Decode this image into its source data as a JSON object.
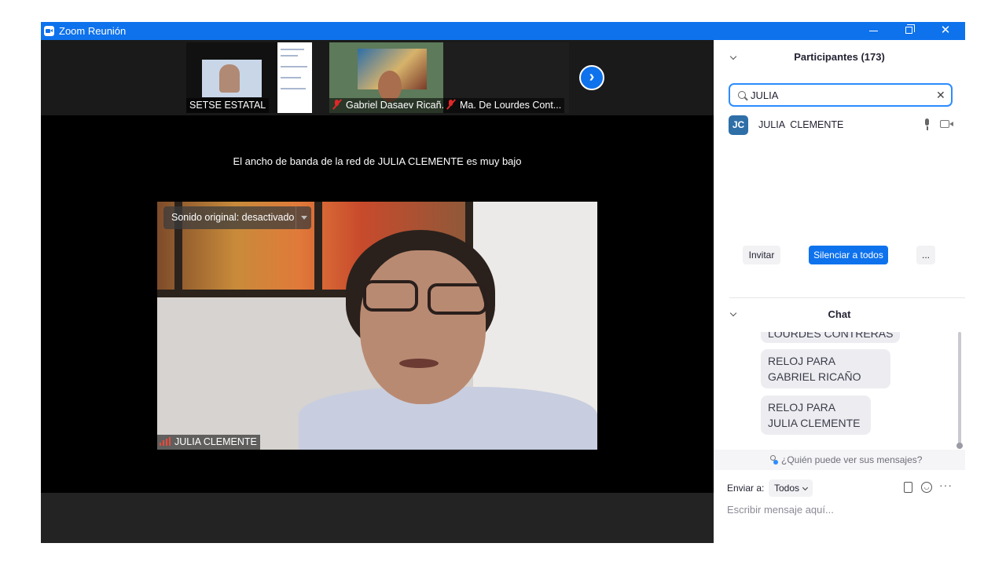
{
  "window": {
    "title": "Zoom Reunión",
    "accent_color": "#0e72ed",
    "controls": {
      "minimize_icon": "minimize-icon",
      "restore_icon": "restore-icon",
      "close_icon": "close-icon",
      "close_glyph": "✕"
    }
  },
  "thumbnails": [
    {
      "name": "SETSE ESTATAL",
      "muted": false
    },
    {
      "name": "Gabriel Dasaev Ricañ...",
      "muted": true
    },
    {
      "name": "Ma. De Lourdes Cont...",
      "muted": true
    }
  ],
  "next_page_glyph": "›",
  "main_video": {
    "bandwidth_message": "El ancho de banda de la red de JULIA  CLEMENTE es muy bajo",
    "audio_status": "Sonido original: desactivado",
    "speaker_name": "JULIA  CLEMENTE"
  },
  "participants": {
    "title": "Participantes (173)",
    "search_value": "JULIA",
    "clear_glyph": "✕",
    "list": [
      {
        "initials": "JC",
        "name": "JULIA  CLEMENTE",
        "avatar_color": "#2f6fa8"
      }
    ],
    "invite_label": "Invitar",
    "mute_all_label": "Silenciar a todos",
    "more_label": "..."
  },
  "chat": {
    "title": "Chat",
    "messages": [
      "LOURDES CONTRERAS",
      "RELOJ PARA  GABRIEL RICAÑO",
      "RELOJ PARA JULIA CLEMENTE"
    ],
    "visibility_link": "¿Quién puede ver sus mensajes?",
    "send_to_label": "Enviar a:",
    "send_to_value": "Todos",
    "more_glyph": "···",
    "emoji_glyph": "◡",
    "input_placeholder": "Escribir mensaje aquí..."
  }
}
